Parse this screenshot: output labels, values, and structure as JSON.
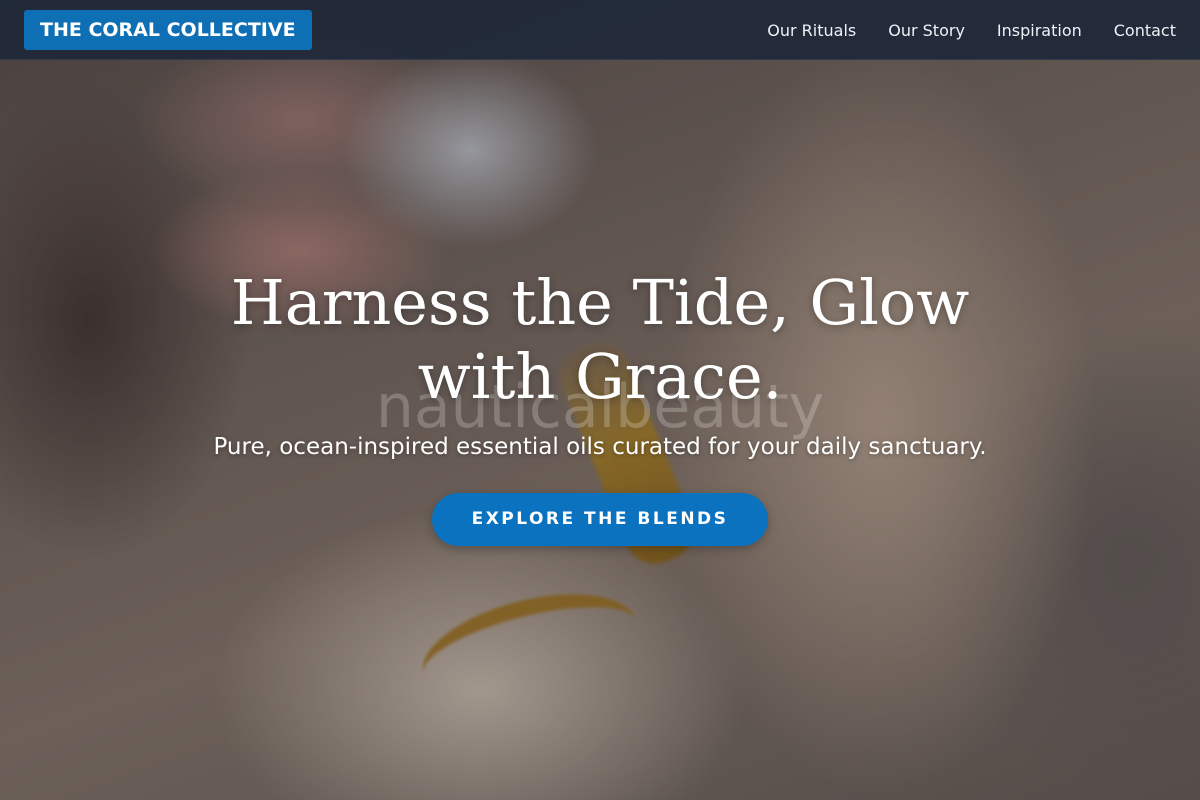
{
  "header": {
    "brand": "THE CORAL COLLECTIVE",
    "nav": [
      {
        "label": "Our Rituals"
      },
      {
        "label": "Our Story"
      },
      {
        "label": "Inspiration"
      },
      {
        "label": "Contact"
      }
    ]
  },
  "hero": {
    "headline": "Harness the Tide, Glow with Grace.",
    "watermark": "nauticalbeauty",
    "subheadline": "Pure, ocean-inspired essential oils curated for your daily sanctuary.",
    "cta_label": "EXPLORE THE BLENDS",
    "image_description_icon": "oil-dropper-photo"
  },
  "colors": {
    "brand_blue": "#0f6fb5",
    "cta_blue": "#0b72bf",
    "header_bg": "#1e283a",
    "text_white": "#ffffff"
  }
}
